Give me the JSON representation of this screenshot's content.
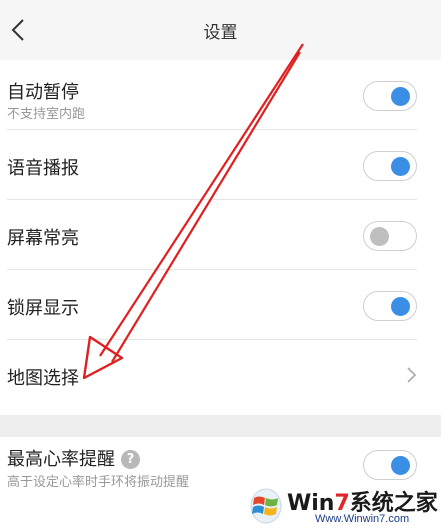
{
  "header": {
    "title": "设置"
  },
  "settings": [
    {
      "label": "自动暂停",
      "sub": "不支持室内跑",
      "control": "toggle",
      "on": true
    },
    {
      "label": "语音播报",
      "control": "toggle",
      "on": true
    },
    {
      "label": "屏幕常亮",
      "control": "toggle",
      "on": false
    },
    {
      "label": "锁屏显示",
      "control": "toggle",
      "on": true
    },
    {
      "label": "地图选择",
      "control": "chevron"
    }
  ],
  "heart_rate": {
    "label": "最高心率提醒",
    "help": "?",
    "sub": "高于设定心率时手环将振动提醒",
    "on": true
  },
  "watermark": {
    "brand_a": "Win",
    "brand_b": "7",
    "brand_c": "系统之家",
    "url": "Www.Winwin7.com"
  },
  "colors": {
    "accent": "#3a8ee6",
    "annotation_arrow": "#e02020",
    "toggle_off_knob": "#bfbfbf"
  },
  "icons": {
    "back": "chevron-left-icon",
    "row_action": "chevron-right-icon",
    "help": "question-circle-icon"
  }
}
